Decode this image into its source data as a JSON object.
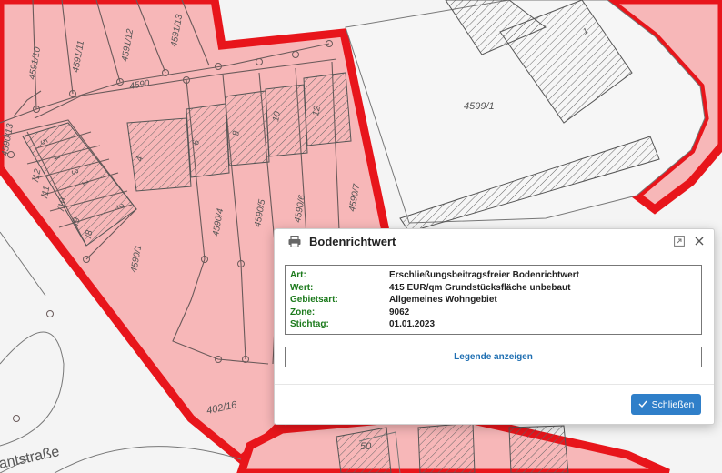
{
  "map": {
    "parcel_labels": [
      "4591/10",
      "4591/11",
      "4591/12",
      "4591/13",
      "4590",
      "4599/1",
      "4590/13",
      "6",
      "8",
      "10",
      "12",
      "4",
      "5",
      "/12",
      "/11",
      "/10",
      "/9",
      "/8",
      "4590/4",
      "4590/5",
      "4590/6",
      "4590/7",
      "4590/1",
      "1",
      "3",
      "4",
      "2",
      "402/16",
      "50",
      "1"
    ],
    "street_label": "antstraße",
    "colors": {
      "zone_fill": "#f7b7b8",
      "zone_border": "#e8151b",
      "parcel_line": "#6a5a5a",
      "background": "#f4f4f4"
    }
  },
  "dialog": {
    "title": "Bodenrichtwert",
    "icons": {
      "print": "print-icon",
      "expand": "expand-icon",
      "close": "close-icon",
      "confirm": "check-icon"
    },
    "rows": [
      {
        "key": "Art:",
        "value": "Erschließungsbeitragsfreier Bodenrichtwert"
      },
      {
        "key": "Wert:",
        "value": "415 EUR/qm Grundstücksfläche unbebaut"
      },
      {
        "key": "Gebietsart:",
        "value": "Allgemeines Wohngebiet"
      },
      {
        "key": "Zone:",
        "value": "9062"
      },
      {
        "key": "Stichtag:",
        "value": "01.01.2023"
      }
    ],
    "legend_button": "Legende anzeigen",
    "close_button": "Schließen",
    "colors": {
      "key_text": "#1c7a1c",
      "legend_text": "#1f6fb2",
      "primary_button": "#2f7fc9"
    }
  }
}
